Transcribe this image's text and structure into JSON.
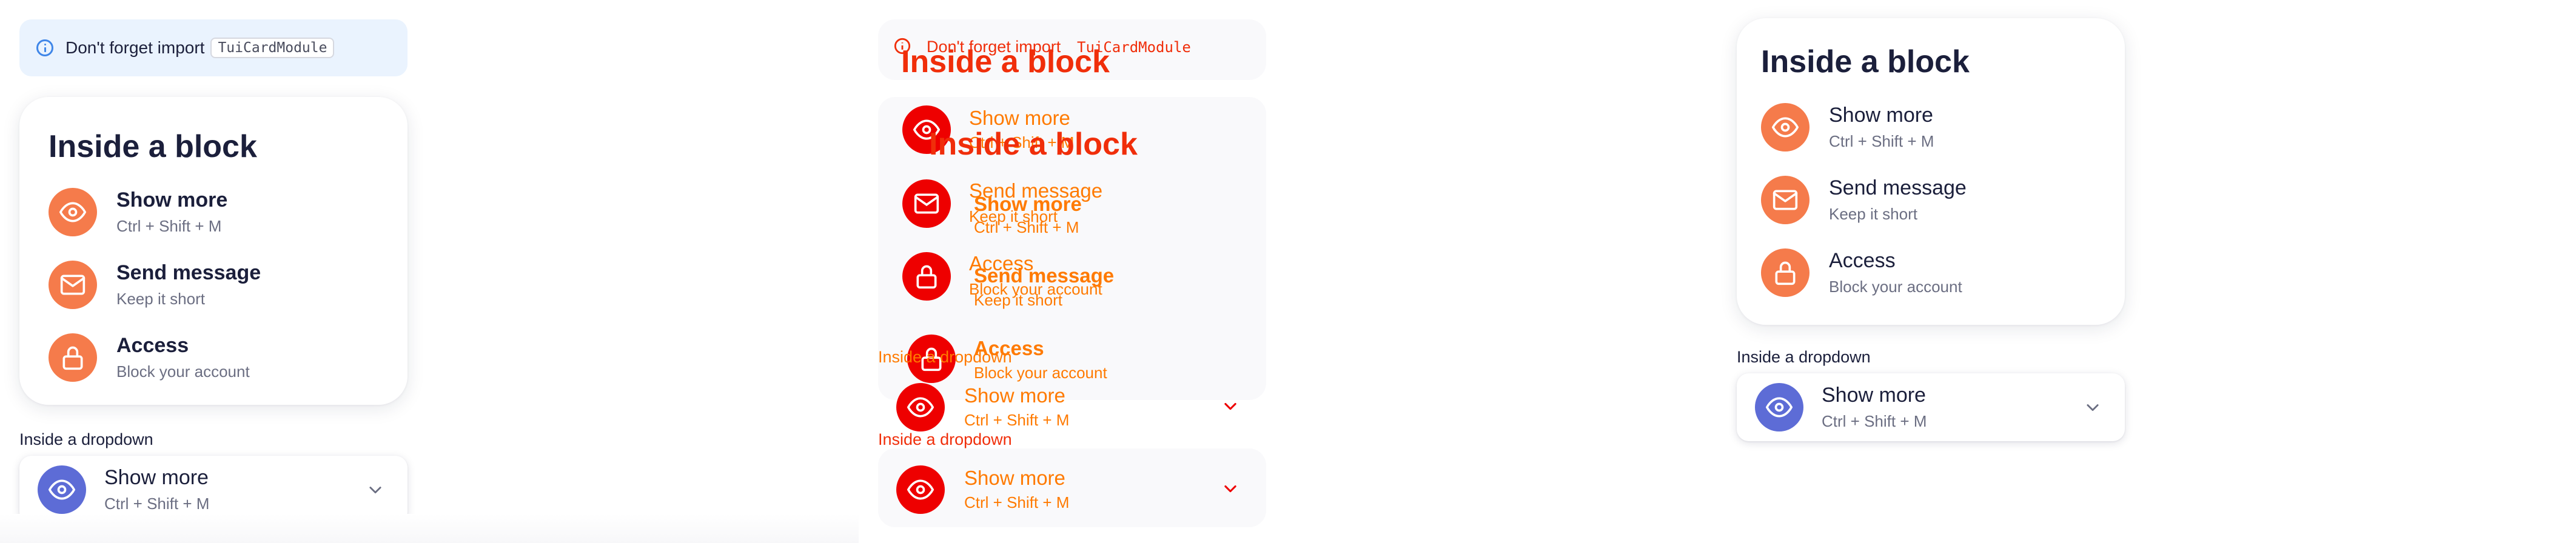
{
  "notice": {
    "text": "Don't forget import",
    "code": "TuiCardModule",
    "icon": "info-icon"
  },
  "block": {
    "title": "Inside a block",
    "items": [
      {
        "icon": "eye-icon",
        "title": "Show more",
        "subtitle": "Ctrl + Shift + M"
      },
      {
        "icon": "mail-icon",
        "title": "Send message",
        "subtitle": "Keep it short"
      },
      {
        "icon": "lock-icon",
        "title": "Access",
        "subtitle": "Block your account"
      }
    ]
  },
  "dropdown": {
    "label": "Inside a dropdown",
    "item": {
      "icon": "eye-icon",
      "title": "Show more",
      "subtitle": "Ctrl + Shift + M"
    },
    "chevron": "chevron-down-icon"
  },
  "colors": {
    "accent_orange": "#f57b4b",
    "accent_blue": "#5d6cd6",
    "notice_bg": "#eaf3fe",
    "info_blue": "#3f86e8",
    "text_primary": "#1b1f3b",
    "text_secondary": "#6b6e82",
    "broken_red": "#f02e0a",
    "broken_orange": "#ff7a00"
  }
}
